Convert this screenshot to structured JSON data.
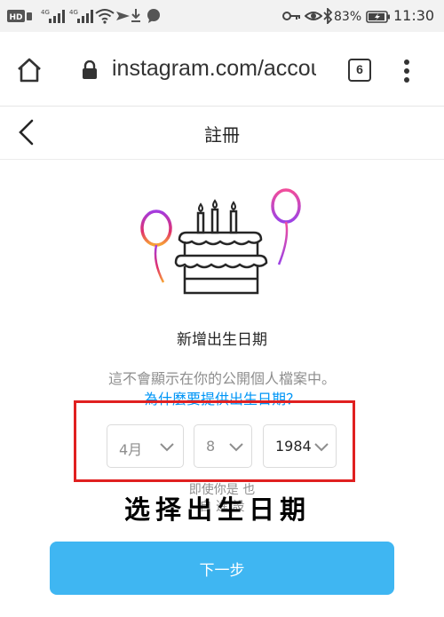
{
  "status_bar": {
    "network_label": "HD",
    "signal_1_label": "4G",
    "signal_2_label": "4G",
    "battery_percent": "83%",
    "time": "11:30"
  },
  "browser": {
    "url": "instagram.com/accoun",
    "tab_count": "6"
  },
  "header": {
    "title": "註冊"
  },
  "main": {
    "heading": "新增出生日期",
    "description": "這不會顯示在你的公開個人檔案中。",
    "why_link": "為什麼要提供出生日期？",
    "month": {
      "value": "4月"
    },
    "day": {
      "value": "8"
    },
    "year": {
      "value": "1984"
    },
    "helper_line1": "即使你是                                        也",
    "helper_line2": "                          自           進      設",
    "next_button": "下一步"
  },
  "overlay_caption": "选择出生日期",
  "colors": {
    "accent_link": "#0095f6",
    "button_bg": "#3fb6f2",
    "highlight_red": "#e02020",
    "balloon_left": "purple-orange-gradient",
    "balloon_right": "pink-purple-gradient"
  },
  "icons": [
    "home-icon",
    "lock-icon",
    "menu-icon",
    "back-icon",
    "cake-illustration",
    "balloon",
    "chevron-down-icon"
  ]
}
